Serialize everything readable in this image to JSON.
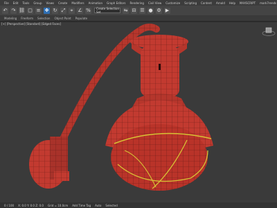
{
  "menubar": {
    "items": [
      "File",
      "Edit",
      "Tools",
      "Group",
      "Views",
      "Create",
      "Modifiers",
      "Animation",
      "Graph Editors",
      "Rendering",
      "Civil View",
      "Customize",
      "Scripting",
      "Content",
      "Arnold",
      "Help",
      "MAXSCRIPT",
      "mark7rends"
    ]
  },
  "toolbar": {
    "selection_set": "Create Selection Set"
  },
  "ribbon": {
    "tabs": [
      "Modeling",
      "Freeform",
      "Selection",
      "Object Paint",
      "Populate"
    ]
  },
  "viewport": {
    "label": "[+] [Perspective] [Standard] [Edged Faces]",
    "colors": {
      "lamp": "#c23a30",
      "wire": "#2b0b09",
      "highlight": "#d7c234",
      "background": "#3a3a3a"
    }
  },
  "statusbar": {
    "frame": "0 / 100",
    "coords": "X: 0.0  Y: 0.0  Z: 0.0",
    "grid": "Grid = 10.0cm",
    "add_time_tag": "Add Time Tag",
    "auto": "Auto",
    "selected": "Selected"
  }
}
